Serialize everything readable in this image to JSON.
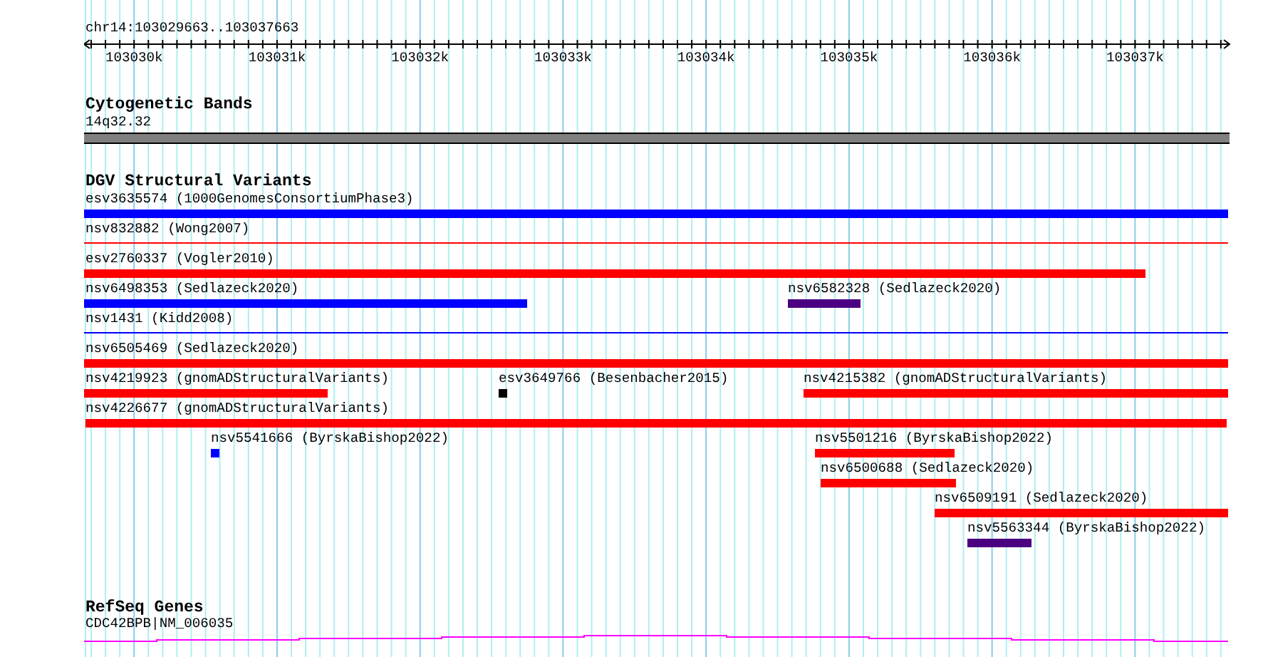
{
  "ruler": {
    "location": "chr14:103029663..103037663",
    "ticks": [
      "103030k",
      "103031k",
      "103032k",
      "103033k",
      "103034k",
      "103035k",
      "103036k",
      "103037k"
    ]
  },
  "tracks": [
    {
      "kind": "cytoband",
      "title": "Cytogenetic Bands",
      "features": [
        {
          "label": "14q32.32",
          "color": "#808080"
        }
      ]
    },
    {
      "kind": "variants",
      "title": "DGV Structural Variants",
      "features": [
        {
          "label": "esv3635574 (1000GenomesConsortiumPhase3)",
          "color": "#0000ff"
        },
        {
          "label": "nsv832882 (Wong2007)",
          "color": "#ff0000"
        },
        {
          "label": "esv2760337 (Vogler2010)",
          "color": "#ff0000"
        },
        {
          "label": "nsv6498353 (Sedlazeck2020)",
          "color": "#0000ff"
        },
        {
          "label": "nsv6582328 (Sedlazeck2020)",
          "color": "#4b0082"
        },
        {
          "label": "nsv1431 (Kidd2008)",
          "color": "#0000ff"
        },
        {
          "label": "nsv6505469 (Sedlazeck2020)",
          "color": "#ff0000"
        },
        {
          "label": "nsv4219923 (gnomADStructuralVariants)",
          "color": "#ff0000"
        },
        {
          "label": "esv3649766 (Besenbacher2015)",
          "color": "#000000"
        },
        {
          "label": "nsv4215382 (gnomADStructuralVariants)",
          "color": "#ff0000"
        },
        {
          "label": "nsv4226677 (gnomADStructuralVariants)",
          "color": "#ff0000"
        },
        {
          "label": "nsv5541666 (ByrskaBishop2022)",
          "color": "#0000ff"
        },
        {
          "label": "nsv5501216 (ByrskaBishop2022)",
          "color": "#ff0000"
        },
        {
          "label": "nsv6500688 (Sedlazeck2020)",
          "color": "#ff0000"
        },
        {
          "label": "nsv6509191 (Sedlazeck2020)",
          "color": "#ff0000"
        },
        {
          "label": "nsv5563344 (ByrskaBishop2022)",
          "color": "#4b0082"
        }
      ]
    },
    {
      "kind": "genes",
      "title": "RefSeq Genes",
      "features": [
        {
          "label": "CDC42BPB|NM_006035",
          "color": "#ff00ff"
        }
      ]
    }
  ]
}
